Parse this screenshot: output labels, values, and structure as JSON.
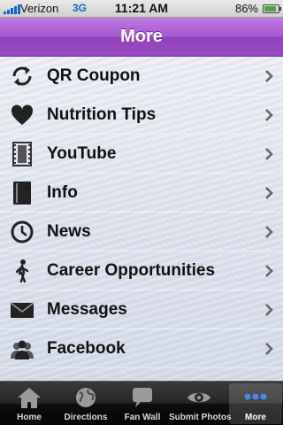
{
  "status_bar": {
    "carrier": "Verizon",
    "network": "3G",
    "time": "11:21 AM",
    "battery": "86%",
    "battery_level": 0.86
  },
  "nav": {
    "title": "More"
  },
  "menu": {
    "items": [
      {
        "label": "QR Coupon",
        "icon": "refresh-icon"
      },
      {
        "label": "Nutrition Tips",
        "icon": "heart-icon"
      },
      {
        "label": "YouTube",
        "icon": "film-icon"
      },
      {
        "label": "Info",
        "icon": "book-icon"
      },
      {
        "label": "News",
        "icon": "clock-icon"
      },
      {
        "label": "Career Opportunities",
        "icon": "walking-person-icon"
      },
      {
        "label": "Messages",
        "icon": "envelope-icon"
      },
      {
        "label": "Facebook",
        "icon": "people-icon"
      }
    ]
  },
  "tabs": [
    {
      "label": "Home",
      "icon": "home-icon"
    },
    {
      "label": "Directions",
      "icon": "globe-icon"
    },
    {
      "label": "Fan Wall",
      "icon": "speech-bubble-icon"
    },
    {
      "label": "Submit Photos",
      "icon": "eye-icon"
    },
    {
      "label": "More",
      "icon": "more-dots-icon",
      "active": true
    }
  ]
}
